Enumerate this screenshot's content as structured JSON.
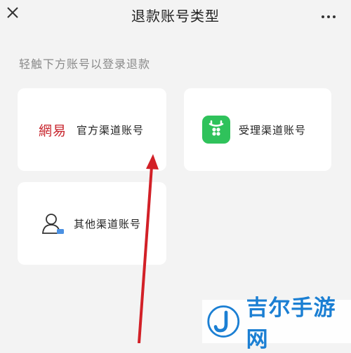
{
  "header": {
    "title": "退款账号类型",
    "close_icon": "close-icon",
    "more_icon": "more-horizontal-icon"
  },
  "hint": "轻触下方账号以登录退款",
  "cards": [
    {
      "logo_text": "網易",
      "label": "官方渠道账号",
      "icon": "netease-logo"
    },
    {
      "label": "受理渠道账号",
      "icon": "green-app-icon"
    },
    {
      "label": "其他渠道账号",
      "icon": "person-account-icon"
    }
  ],
  "watermark": {
    "text": "吉尔手游网",
    "icon": "j-logo-icon"
  },
  "colors": {
    "accent_red": "#d22027",
    "brand_green": "#2fc25b",
    "netease_red": "#c8252d",
    "watermark_blue": "#1b7fd3"
  }
}
